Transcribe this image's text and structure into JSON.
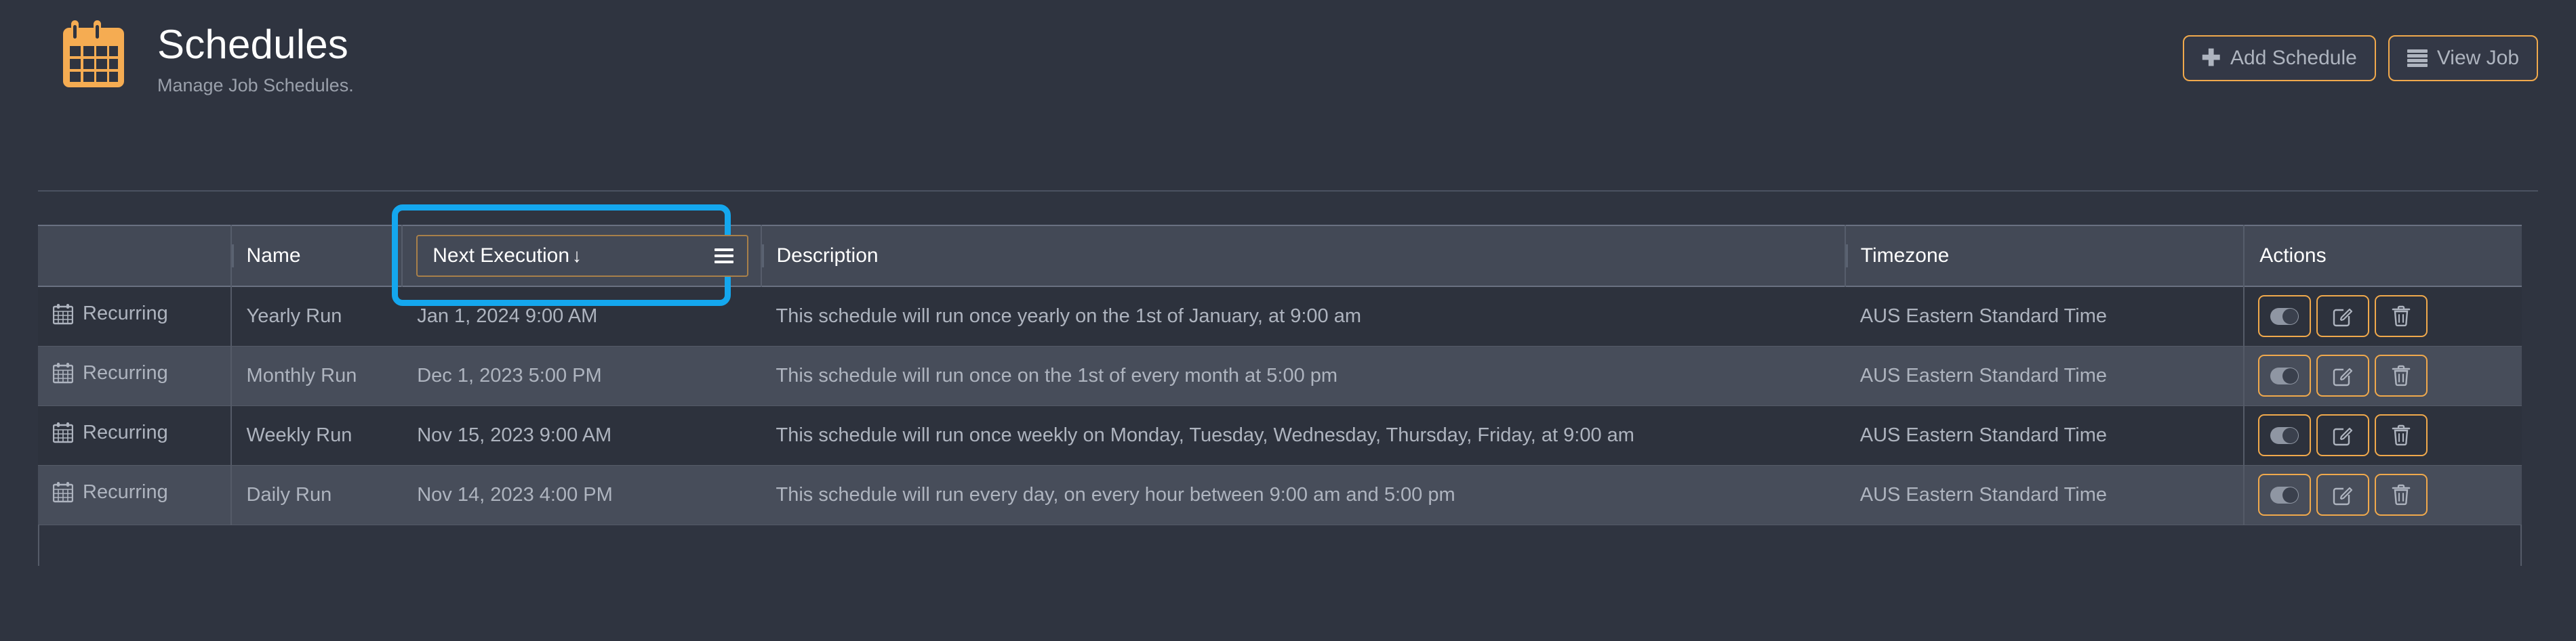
{
  "header": {
    "logo_icon": "calendar-icon",
    "title": "Schedules",
    "subtitle": "Manage Job Schedules.",
    "add_button": {
      "icon": "plus-icon",
      "label": "Add Schedule"
    },
    "view_button": {
      "icon": "list-icon",
      "label": "View Job"
    }
  },
  "colors": {
    "accent_orange": "#f0a94c",
    "highlight_blue": "#14a7ee",
    "page_bg": "#2f3440",
    "header_row_bg": "#434956",
    "row_odd_bg": "#2d323d",
    "row_even_bg": "#474d5a",
    "text_primary": "#ffffff",
    "text_secondary": "#aeb4bf"
  },
  "table": {
    "columns": [
      {
        "key": "type",
        "label": ""
      },
      {
        "key": "name",
        "label": "Name"
      },
      {
        "key": "next_execution",
        "label": "Next Execution",
        "sorted": true,
        "sort_arrow": "↓",
        "menu_icon": "hamburger-menu-icon",
        "highlighted": true
      },
      {
        "key": "description",
        "label": "Description"
      },
      {
        "key": "timezone",
        "label": "Timezone"
      },
      {
        "key": "actions",
        "label": "Actions"
      }
    ],
    "rows": [
      {
        "type_icon": "calendar-icon",
        "type": "Recurring",
        "name": "Yearly Run",
        "next_execution": "Jan 1, 2024 9:00 AM",
        "description": "This schedule will run once yearly on the 1st of January, at 9:00 am",
        "timezone": "AUS Eastern Standard Time"
      },
      {
        "type_icon": "calendar-icon",
        "type": "Recurring",
        "name": "Monthly Run",
        "next_execution": "Dec 1, 2023 5:00 PM",
        "description": "This schedule will run once on the 1st of every month at 5:00 pm",
        "timezone": "AUS Eastern Standard Time"
      },
      {
        "type_icon": "calendar-icon",
        "type": "Recurring",
        "name": "Weekly Run",
        "next_execution": "Nov 15, 2023 9:00 AM",
        "description": "This schedule will run once weekly on Monday, Tuesday, Wednesday, Thursday, Friday, at 9:00 am",
        "timezone": "AUS Eastern Standard Time"
      },
      {
        "type_icon": "calendar-icon",
        "type": "Recurring",
        "name": "Daily Run",
        "next_execution": "Nov 14, 2023 4:00 PM",
        "description": "This schedule will run every day, on every hour between 9:00 am and 5:00 pm",
        "timezone": "AUS Eastern Standard Time"
      }
    ],
    "row_actions": [
      {
        "name": "toggle-enabled",
        "icon": "toggle-switch-icon"
      },
      {
        "name": "edit-schedule",
        "icon": "edit-pencil-icon"
      },
      {
        "name": "delete-schedule",
        "icon": "trash-icon"
      }
    ]
  }
}
